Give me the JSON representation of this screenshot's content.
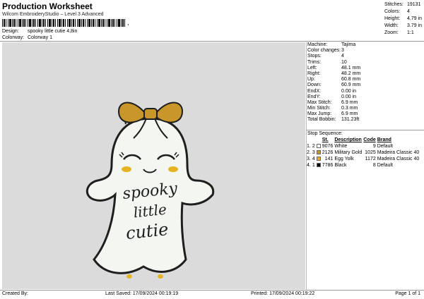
{
  "header": {
    "title": "Production Worksheet",
    "subtitle": "Wilcom EmbroideryStudio – Level 3 Advanced",
    "barcode_end": ",",
    "design_label": "Design:",
    "design_value": "spooky little cutie 4,8in",
    "colorway_label": "Colorway:",
    "colorway_value": "Colorway 1"
  },
  "stats": [
    {
      "label": "Stitches:",
      "value": "19131"
    },
    {
      "label": "Colors:",
      "value": "4"
    },
    {
      "label": "Height:",
      "value": "4.79 in"
    },
    {
      "label": "Width:",
      "value": "3.79 in"
    },
    {
      "label": "Zoom:",
      "value": "1:1"
    }
  ],
  "design_text": {
    "line1": "spooky",
    "line2": "little",
    "line3": "cutie"
  },
  "properties": [
    {
      "label": "Machine:",
      "value": "Tajima"
    },
    {
      "label": "Color changes:",
      "value": "3"
    },
    {
      "label": "Stops:",
      "value": "4"
    },
    {
      "label": "Trims:",
      "value": "10"
    },
    {
      "label": "Left:",
      "value": "48.1 mm"
    },
    {
      "label": "Right:",
      "value": "48.2 mm"
    },
    {
      "label": "Up:",
      "value": "60.8 mm"
    },
    {
      "label": "Down:",
      "value": "60.9 mm"
    },
    {
      "label": "EndX:",
      "value": "0.00 in"
    },
    {
      "label": "EndY:",
      "value": "0.00 in"
    },
    {
      "label": "Max Stitch:",
      "value": "6.9 mm"
    },
    {
      "label": "Min Stitch:",
      "value": "0.3 mm"
    },
    {
      "label": "Max Jump:",
      "value": "6.9 mm"
    },
    {
      "label": "Total Bobbin:",
      "value": "131.23ft"
    }
  ],
  "stop_sequence": {
    "title": "Stop Sequence:",
    "headers": {
      "st": "St.",
      "description": "Description",
      "code": "Code",
      "brand": "Brand"
    },
    "rows": [
      {
        "idx": "1.",
        "n": "2",
        "color": "#ffffff",
        "st": "9076",
        "description": "White",
        "code": "9",
        "brand": "Default"
      },
      {
        "idx": "2.",
        "n": "3",
        "color": "#c8962a",
        "st": "2126",
        "description": "Military Gold",
        "code": "1025",
        "brand": "Madeira Classic 40"
      },
      {
        "idx": "3.",
        "n": "4",
        "color": "#e6b422",
        "st": "141",
        "description": "Egg Yolk",
        "code": "1172",
        "brand": "Madeira Classic 40"
      },
      {
        "idx": "4.",
        "n": "1",
        "color": "#000000",
        "st": "7786",
        "description": "Black",
        "code": "8",
        "brand": "Default"
      }
    ]
  },
  "footer": {
    "created_by": "Created By:",
    "last_saved": "Last Saved: 17/09/2024 00:19:19",
    "printed": "Printed: 17/09/2024 00:19:22",
    "page": "Page 1 of 1"
  }
}
